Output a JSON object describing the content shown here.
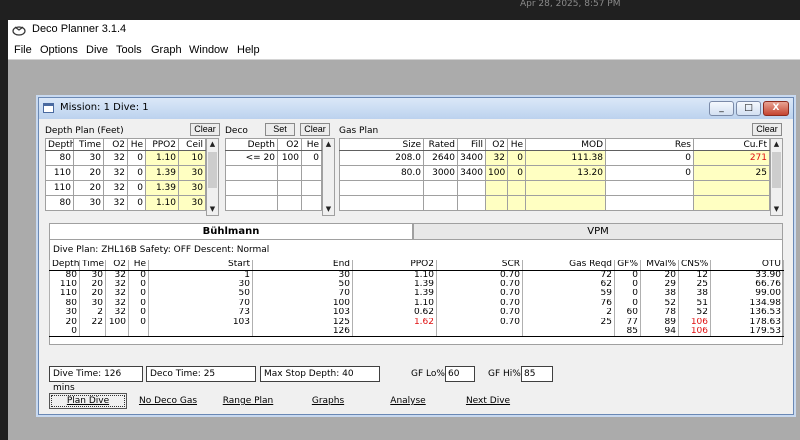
{
  "app": {
    "title": "Deco Planner 3.1.4",
    "menu": [
      "File",
      "Options",
      "Dive",
      "Tools",
      "Graph",
      "Window",
      "Help"
    ]
  },
  "desktop": {
    "clock_fragment": "Apr 28, 2025, 8:57 PM"
  },
  "mdi": {
    "title": "Mission: 1 Dive: 1",
    "buttons": {
      "minimize": "_",
      "maximize": "□",
      "close": "X"
    }
  },
  "depth_plan": {
    "label": "Depth Plan (Feet)",
    "clear": "Clear",
    "headers": [
      "Depth",
      "Time",
      "O2",
      "He",
      "PPO2",
      "Ceil"
    ],
    "rows": [
      [
        "80",
        "30",
        "32",
        "0",
        "1.10",
        "10"
      ],
      [
        "110",
        "20",
        "32",
        "0",
        "1.39",
        "30"
      ],
      [
        "110",
        "20",
        "32",
        "0",
        "1.39",
        "30"
      ],
      [
        "80",
        "30",
        "32",
        "0",
        "1.10",
        "30"
      ]
    ]
  },
  "deco": {
    "label": "Deco",
    "set": "Set",
    "clear": "Clear",
    "headers": [
      "Depth",
      "O2",
      "He"
    ],
    "rows": [
      [
        "<= 20",
        "100",
        "0"
      ],
      [
        "",
        "",
        ""
      ],
      [
        "",
        "",
        ""
      ],
      [
        "",
        "",
        ""
      ]
    ]
  },
  "gas_plan": {
    "label": "Gas Plan",
    "clear": "Clear",
    "headers": [
      "Size",
      "Rated",
      "Fill",
      "O2",
      "He",
      "MOD",
      "Res",
      "Cu.Ft"
    ],
    "rows": [
      [
        "208.0",
        "2640",
        "3400",
        "32",
        "0",
        "111.38",
        "0",
        "271"
      ],
      [
        "80.0",
        "3000",
        "3400",
        "100",
        "0",
        "13.20",
        "0",
        "25"
      ],
      [
        "",
        "",
        "",
        "",
        "",
        "",
        "",
        ""
      ],
      [
        "",
        "",
        "",
        "",
        "",
        "",
        "",
        ""
      ]
    ]
  },
  "tabs": {
    "buhlmann": "Bühlmann",
    "vpm": "VPM"
  },
  "plan_info": "Dive Plan: ZHL16B  Safety: OFF  Descent: Normal",
  "results": {
    "headers": [
      "Depth",
      "Time",
      "O2",
      "He",
      "Start",
      "End",
      "PPO2",
      "SCR",
      "Gas Reqd",
      "GF%",
      "MVal%",
      "CNS%",
      "OTU"
    ],
    "rows": [
      [
        "80",
        "30",
        "32",
        "0",
        "1",
        "30",
        "1.10",
        "0.70",
        "72",
        "0",
        "20",
        "12",
        "33.90"
      ],
      [
        "110",
        "20",
        "32",
        "0",
        "30",
        "50",
        "1.39",
        "0.70",
        "62",
        "0",
        "29",
        "25",
        "66.76"
      ],
      [
        "110",
        "20",
        "32",
        "0",
        "50",
        "70",
        "1.39",
        "0.70",
        "59",
        "0",
        "38",
        "38",
        "99.00"
      ],
      [
        "80",
        "30",
        "32",
        "0",
        "70",
        "100",
        "1.10",
        "0.70",
        "76",
        "0",
        "52",
        "51",
        "134.98"
      ],
      [
        "30",
        "2",
        "32",
        "0",
        "73",
        "103",
        "0.62",
        "0.70",
        "2",
        "60",
        "78",
        "52",
        "136.53"
      ],
      [
        "20",
        "22",
        "100",
        "0",
        "103",
        "125",
        "1.62",
        "0.70",
        "25",
        "77",
        "89",
        "106",
        "178.63"
      ],
      [
        "0",
        "",
        "",
        "",
        "",
        "126",
        "",
        "",
        "",
        "85",
        "94",
        "106",
        "179.53"
      ]
    ]
  },
  "summary": {
    "dive_time": "Dive Time: 126 mins",
    "deco_time": "Deco Time: 25",
    "max_stop": "Max Stop Depth: 40",
    "gf_lo_label": "GF Lo%:",
    "gf_lo": "60",
    "gf_hi_label": "GF Hi%:",
    "gf_hi": "85"
  },
  "bottom_buttons": [
    "Plan Dive",
    "No Deco Gas",
    "Range Plan",
    "Graphs",
    "Analyse",
    "Next Dive"
  ],
  "colors": {
    "highlight_yellow": "#ffffc2",
    "warning_red": "#e01010"
  }
}
